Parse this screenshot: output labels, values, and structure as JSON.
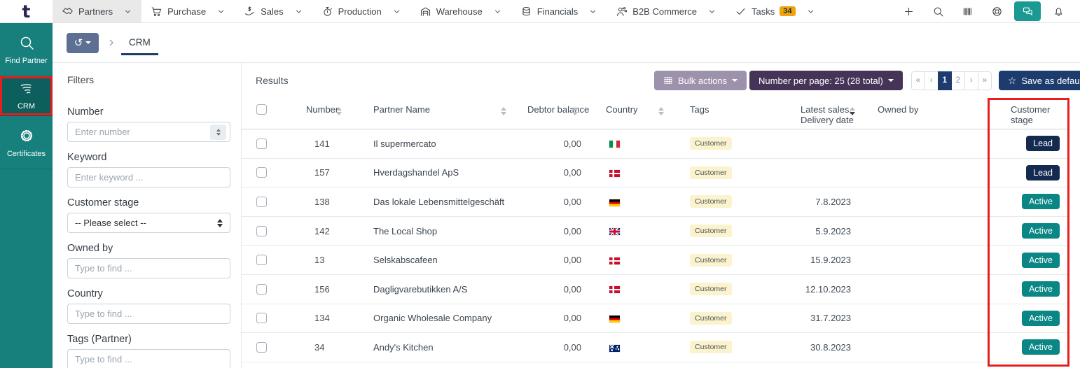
{
  "topbar": {
    "logo": "t",
    "menus": [
      {
        "label": "Partners",
        "active": true
      },
      {
        "label": "Purchase"
      },
      {
        "label": "Sales"
      },
      {
        "label": "Production"
      },
      {
        "label": "Warehouse"
      },
      {
        "label": "Financials"
      },
      {
        "label": "B2B Commerce"
      },
      {
        "label": "Tasks",
        "badge": "34"
      }
    ]
  },
  "sidebar": {
    "items": [
      {
        "label": "Find Partner"
      },
      {
        "label": "CRM",
        "active": true,
        "annotated": true
      },
      {
        "label": "Certificates"
      }
    ]
  },
  "breadcrumb": {
    "current": "CRM"
  },
  "filters": {
    "title": "Filters",
    "number_label": "Number",
    "number_placeholder": "Enter number",
    "keyword_label": "Keyword",
    "keyword_placeholder": "Enter keyword ...",
    "stage_label": "Customer stage",
    "stage_value": "-- Please select --",
    "owned_label": "Owned by",
    "owned_placeholder": "Type to find ...",
    "country_label": "Country",
    "country_placeholder": "Type to find ...",
    "tags_label": "Tags (Partner)",
    "tags_placeholder": "Type to find ..."
  },
  "results": {
    "title": "Results",
    "bulk_actions": "Bulk actions",
    "per_page": "Number per page: 25 (28 total)",
    "pager": {
      "first": "«",
      "prev": "‹",
      "p1": "1",
      "p2": "2",
      "next": "›",
      "last": "»",
      "active_page": "1"
    },
    "save_default": "Save as default",
    "columns": {
      "number": "Number",
      "name": "Partner Name",
      "balance": "Debtor balance",
      "country": "Country",
      "tags": "Tags",
      "latest": "Latest sales, Delivery date",
      "owned": "Owned by",
      "stage": "Customer stage"
    },
    "sorted_by": "Latest sales, Delivery date (desc)",
    "rows": [
      {
        "number": "141",
        "name": "Il supermercato",
        "balance": "0,00",
        "country": "it",
        "tag": "Customer",
        "date": "",
        "stage": "Lead"
      },
      {
        "number": "157",
        "name": "Hverdagshandel ApS",
        "balance": "0,00",
        "country": "dk",
        "tag": "Customer",
        "date": "",
        "stage": "Lead"
      },
      {
        "number": "138",
        "name": "Das lokale Lebensmittelgeschäft",
        "balance": "0,00",
        "country": "de",
        "tag": "Customer",
        "date": "7.8.2023",
        "stage": "Active"
      },
      {
        "number": "142",
        "name": "The Local Shop",
        "balance": "0,00",
        "country": "gb",
        "tag": "Customer",
        "date": "5.9.2023",
        "stage": "Active"
      },
      {
        "number": "13",
        "name": "Selskabscafeen",
        "balance": "0,00",
        "country": "dk",
        "tag": "Customer",
        "date": "15.9.2023",
        "stage": "Active"
      },
      {
        "number": "156",
        "name": "Dagligvarebutikken A/S",
        "balance": "0,00",
        "country": "dk",
        "tag": "Customer",
        "date": "12.10.2023",
        "stage": "Active"
      },
      {
        "number": "134",
        "name": "Organic Wholesale Company",
        "balance": "0,00",
        "country": "de",
        "tag": "Customer",
        "date": "31.7.2023",
        "stage": "Active"
      },
      {
        "number": "34",
        "name": "Andy's Kitchen",
        "balance": "0,00",
        "country": "au",
        "tag": "Customer",
        "date": "30.8.2023",
        "stage": "Active"
      }
    ]
  },
  "colors": {
    "sidebar_teal": "#17807d",
    "stage_lead": "#142a50",
    "stage_active": "#0a8685",
    "tasks_badge": "#f0a30a",
    "annotation_red": "#e61e1e"
  }
}
